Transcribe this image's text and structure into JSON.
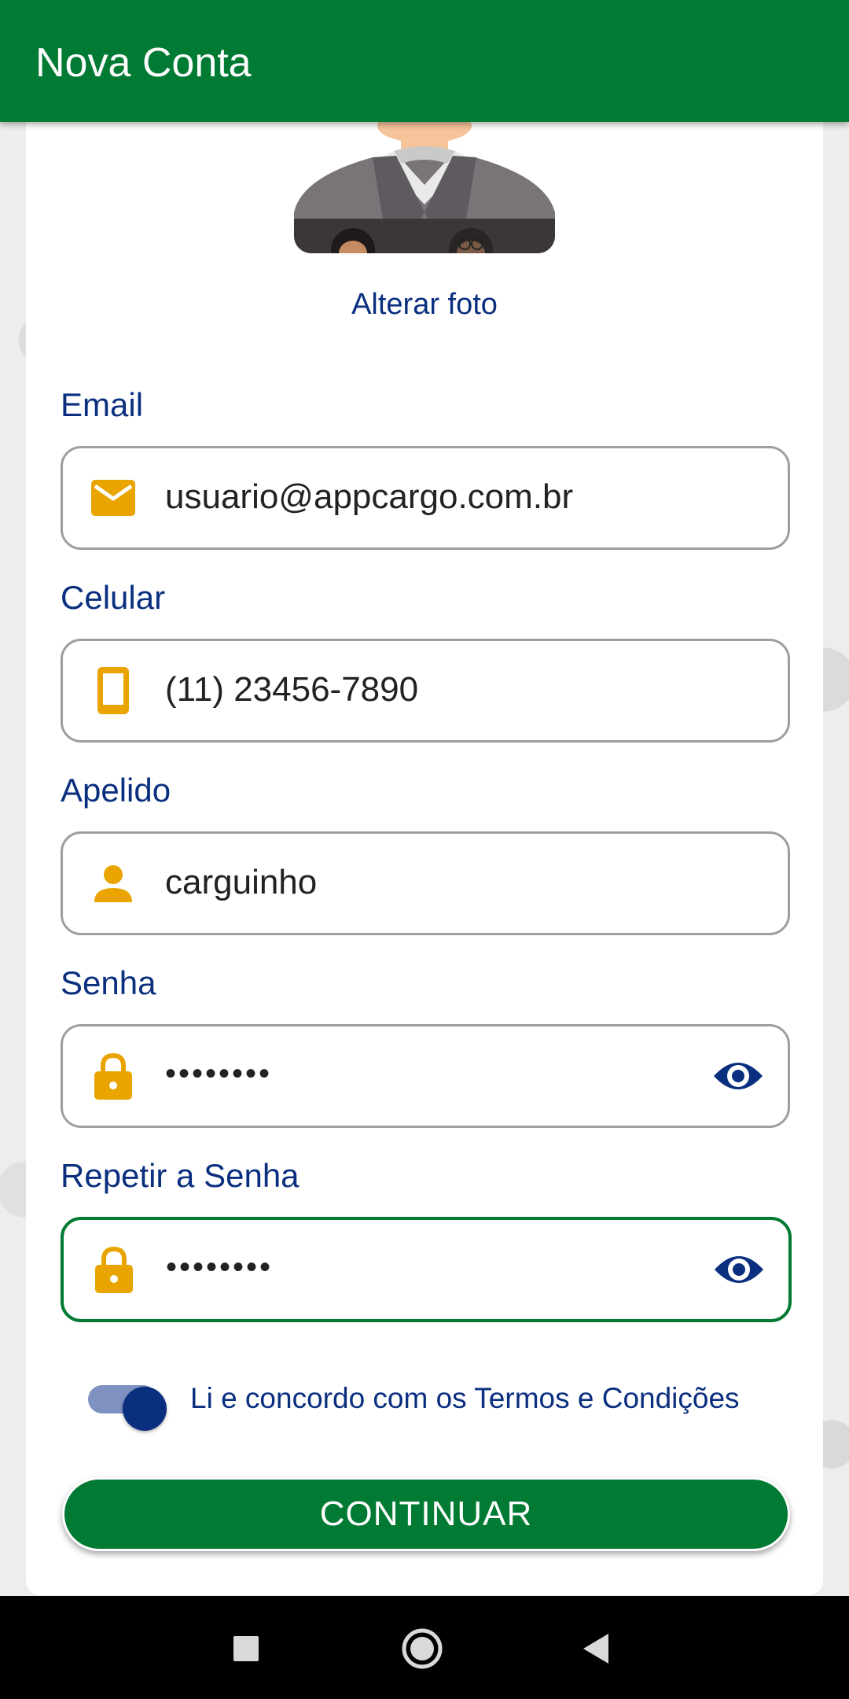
{
  "appbar": {
    "title": "Nova Conta"
  },
  "profile": {
    "change_photo_label": "Alterar foto"
  },
  "form": {
    "email": {
      "label": "Email",
      "value": "usuario@appcargo.com.br",
      "icon": "mail-icon"
    },
    "phone": {
      "label": "Celular",
      "value": "(11) 23456-7890",
      "icon": "phone-icon"
    },
    "nickname": {
      "label": "Apelido",
      "value": "carguinho",
      "icon": "person-icon"
    },
    "password": {
      "label": "Senha",
      "value": "••••••••",
      "icon": "lock-icon"
    },
    "repeat_password": {
      "label": "Repetir a Senha",
      "value": "••••••••",
      "icon": "lock-icon"
    }
  },
  "terms": {
    "label": "Li e concordo com os Termos e Condições",
    "accepted": true
  },
  "actions": {
    "continue_label": "CONTINUAR"
  },
  "colors": {
    "primary": "#017a33",
    "accent_blue": "#0a2f7f",
    "icon_orange": "#e9a400",
    "field_border": "#9e9e9e"
  },
  "navbar": {
    "buttons": [
      "square-icon",
      "circle-icon",
      "back-triangle-icon"
    ]
  }
}
